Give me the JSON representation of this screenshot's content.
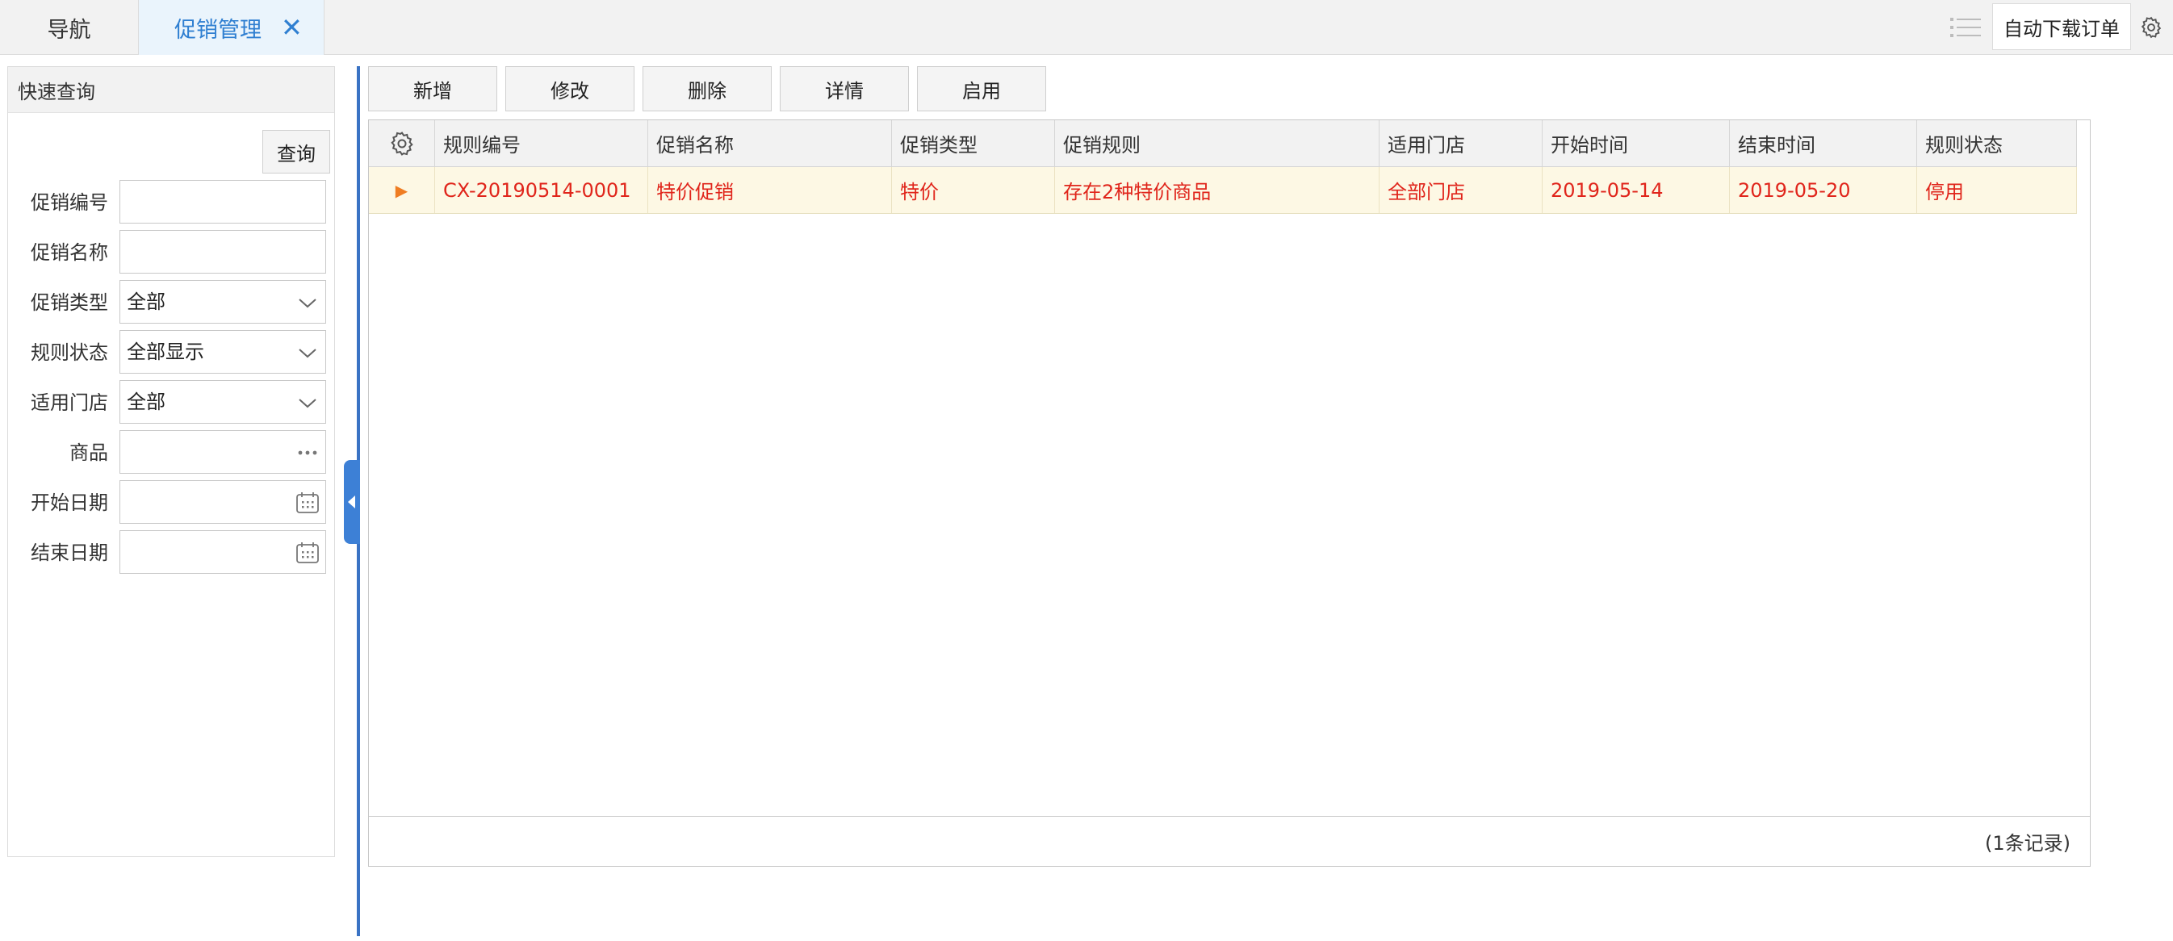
{
  "tabs": {
    "nav_label": "导航",
    "promo_label": "促销管理",
    "close_symbol": "✕"
  },
  "topbar": {
    "auto_download_label": "自动下载订单",
    "list_icon": "list-icon",
    "settings_icon": "gear-icon"
  },
  "quick_search": {
    "title": "快速查询",
    "query_label": "查询",
    "fields": [
      {
        "label": "促销编号",
        "value": "",
        "type": "text"
      },
      {
        "label": "促销名称",
        "value": "",
        "type": "text"
      },
      {
        "label": "促销类型",
        "value": "全部",
        "type": "select"
      },
      {
        "label": "规则状态",
        "value": "全部显示",
        "type": "select"
      },
      {
        "label": "适用门店",
        "value": "全部",
        "type": "select"
      },
      {
        "label": "商品",
        "value": "",
        "type": "picker"
      },
      {
        "label": "开始日期",
        "value": "",
        "type": "date"
      },
      {
        "label": "结束日期",
        "value": "",
        "type": "date"
      }
    ]
  },
  "toolbar": {
    "add_label": "新增",
    "edit_label": "修改",
    "delete_label": "删除",
    "detail_label": "详情",
    "enable_label": "启用"
  },
  "grid": {
    "columns": [
      "规则编号",
      "促销名称",
      "促销类型",
      "促销规则",
      "适用门店",
      "开始时间",
      "结束时间",
      "规则状态"
    ],
    "rows": [
      [
        "CX-20190514-0001",
        "特价促销",
        "特价",
        "存在2种特价商品",
        "全部门店",
        "2019-05-14",
        "2019-05-20",
        "停用"
      ]
    ],
    "row_marker": "▶",
    "footer_count": "(1条记录)"
  },
  "colors": {
    "accent": "#2f7fd1",
    "splitter": "#3a73c4",
    "row_highlight": "#fdf8e4",
    "row_text": "#e0251b",
    "row_marker": "#ef7d22"
  }
}
